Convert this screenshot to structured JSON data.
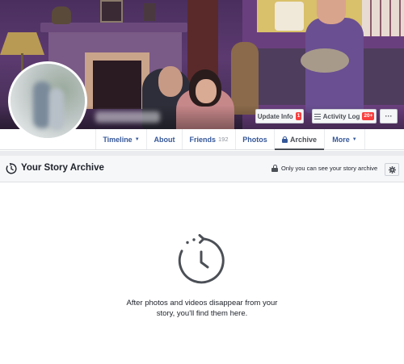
{
  "cover": {
    "buttons": {
      "update_info": "Update Info",
      "update_info_badge": "1",
      "activity_log": "Activity Log",
      "activity_log_badge": "20+",
      "more": "···"
    }
  },
  "tabs": [
    {
      "label": "Timeline",
      "has_caret": true
    },
    {
      "label": "About"
    },
    {
      "label": "Friends",
      "count": "192"
    },
    {
      "label": "Photos"
    },
    {
      "label": "Archive",
      "active": true,
      "icon": "lock-icon"
    },
    {
      "label": "More",
      "has_caret": true
    }
  ],
  "archive": {
    "title": "Your Story Archive",
    "privacy_text": "Only you can see your story archive",
    "header_icon": "story-archive-clock-icon",
    "settings_icon": "gear-icon"
  },
  "empty_state": {
    "icon": "archive-clock-icon",
    "line1": "After photos and videos disappear from your",
    "line2": "story, you'll find them here."
  },
  "colors": {
    "link_blue": "#365899",
    "badge_red": "#fa3e3e",
    "header_bg": "#f6f7f9",
    "cover_purple": "#5c3a70"
  }
}
